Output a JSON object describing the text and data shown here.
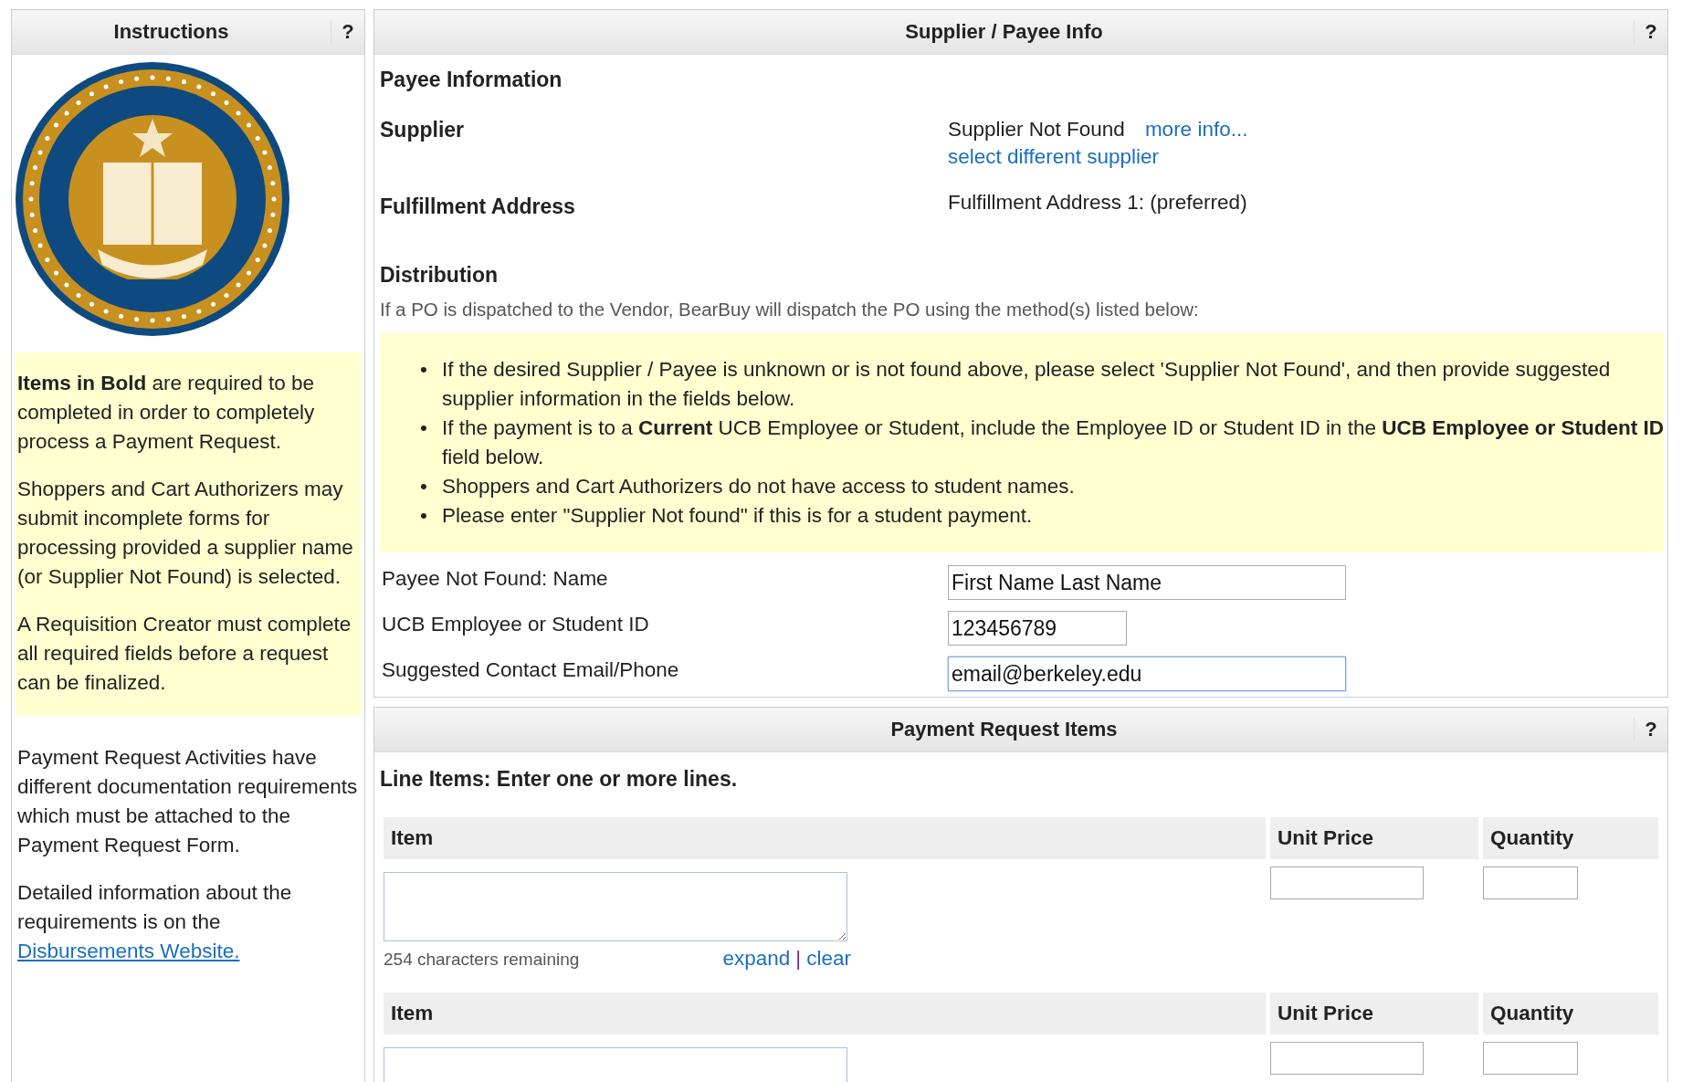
{
  "instructions": {
    "title": "Instructions",
    "help": "?",
    "highlighted": [
      "**Items in Bold** are required to be completed in order to completely process a Payment Request.",
      "Shoppers and Cart Authorizers may submit incomplete forms for processing provided a supplier name (or Supplier Not Found) is selected.",
      "A Requisition Creator must complete all required fields before a request can be finalized."
    ],
    "paragraphs": [
      "Payment Request Activities have different documentation requirements which must be attached to the Payment Request Form."
    ],
    "link_paragraph": {
      "text": "Detailed information about the requirements is on the",
      "link": "Disbursements Website."
    }
  },
  "supplier_panel": {
    "title": "Supplier / Payee Info",
    "help": "?",
    "section": "Payee Information",
    "supplier": {
      "label": "Supplier",
      "value": "Supplier Not Found",
      "more_link": "more info...",
      "change_link": "select different supplier"
    },
    "address": {
      "label": "Fulfillment Address",
      "value": "Fulfillment Address 1: (preferred)"
    },
    "distribution": {
      "title": "Distribution",
      "note": "If a PO is dispatched to the Vendor, BearBuy will dispatch the PO using the method(s) listed below:"
    },
    "bullets": [
      {
        "marker": "•",
        "text": "If the desired Supplier / Payee is unknown or is not found above, please select 'Supplier Not Found', and then provide suggested supplier information in the fields below."
      },
      {
        "marker": "•",
        "text": "If the payment is to a **Current** UCB Employee or Student, include the Employee ID or Student ID in the **UCB Employee or Student ID** field below."
      },
      {
        "marker": "•",
        "text": "Shoppers and Cart Authorizers do not have access to student names."
      },
      {
        "marker": "•",
        "text": "Please enter \"Supplier Not found\" if this is for a student payment."
      }
    ],
    "fields": [
      {
        "label": "Payee Not Found: Name",
        "value": "First Name Last Name",
        "kind": "wide",
        "focused": false
      },
      {
        "label": "UCB Employee or Student ID",
        "value": "123456789",
        "kind": "narrow",
        "focused": false
      },
      {
        "label": "Suggested Contact Email/Phone",
        "value": "email@berkeley.edu",
        "kind": "wide",
        "focused": true
      }
    ]
  },
  "items_panel": {
    "title": "Payment Request Items",
    "help": "?",
    "subtitle": "Line Items: Enter one or more lines.",
    "lines": [
      {
        "columns": [
          "Item",
          "Unit Price",
          "Quantity"
        ],
        "remaining": "254 characters remaining",
        "expand": "expand",
        "separator": "|",
        "clear": "clear"
      },
      {
        "columns": [
          "Item",
          "Unit Price",
          "Quantity"
        ]
      }
    ]
  }
}
